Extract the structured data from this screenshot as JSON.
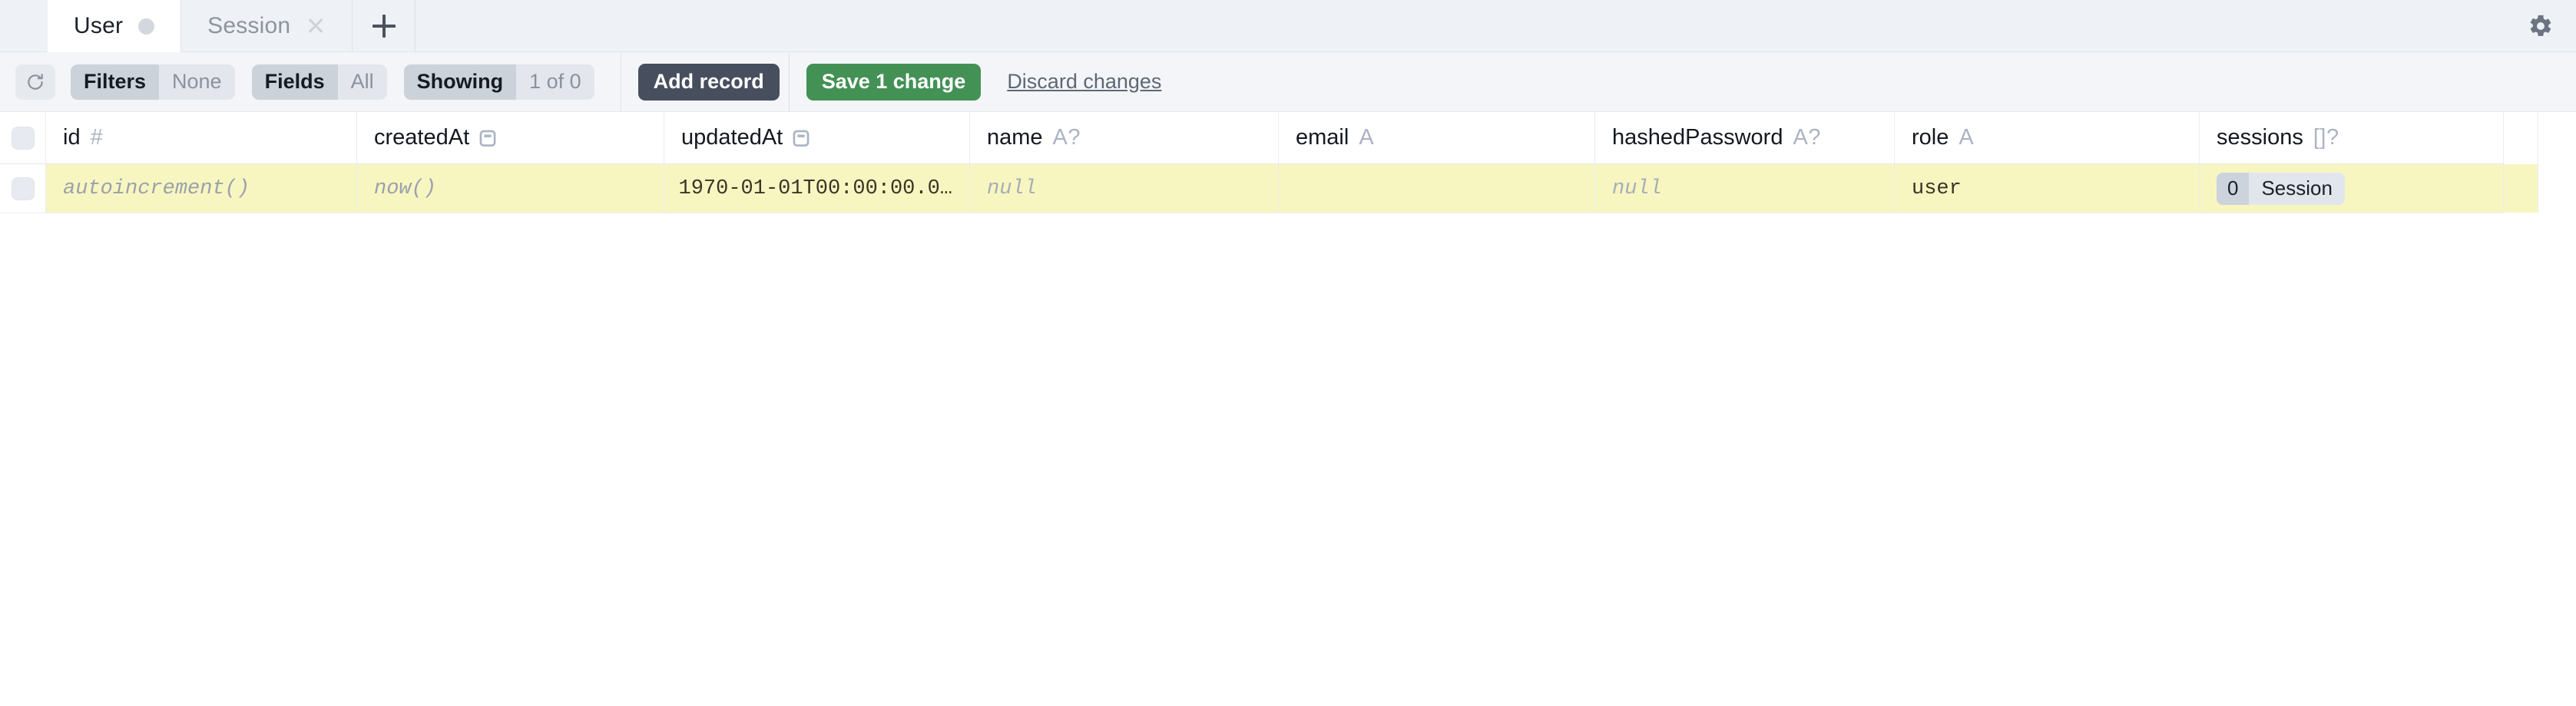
{
  "tabs": [
    {
      "label": "User",
      "active": true,
      "dirty": true,
      "closable": false,
      "name": "tab-user"
    },
    {
      "label": "Session",
      "active": false,
      "dirty": false,
      "closable": true,
      "name": "tab-session"
    }
  ],
  "tabbar": {
    "add_tab_label": "+",
    "settings_icon": "gear-icon"
  },
  "toolbar": {
    "refresh_icon": "refresh-icon",
    "filters_label": "Filters",
    "filters_value": "None",
    "fields_label": "Fields",
    "fields_value": "All",
    "showing_label": "Showing",
    "showing_value": "1 of 0",
    "add_record_label": "Add record",
    "save_label": "Save 1 change",
    "discard_label": "Discard changes"
  },
  "table": {
    "columns": [
      {
        "name": "id",
        "type": "#",
        "icon": "hash-icon"
      },
      {
        "name": "createdAt",
        "type": "",
        "icon": "calendar-icon"
      },
      {
        "name": "updatedAt",
        "type": "",
        "icon": "calendar-icon"
      },
      {
        "name": "name",
        "type": "A?",
        "icon": "string-optional-icon"
      },
      {
        "name": "email",
        "type": "A",
        "icon": "string-icon"
      },
      {
        "name": "hashedPassword",
        "type": "A?",
        "icon": "string-optional-icon"
      },
      {
        "name": "role",
        "type": "A",
        "icon": "string-icon"
      },
      {
        "name": "sessions",
        "type": "[]?",
        "icon": "list-optional-icon"
      }
    ],
    "rows": [
      {
        "changed": true,
        "selected": false,
        "id": "autoincrement()",
        "createdAt": "now()",
        "updatedAt": "1970-01-01T00:00:00.0…",
        "name": "null",
        "email": "",
        "hashedPassword": "null",
        "role": "user",
        "sessions_count": "0",
        "sessions_label": "Session"
      }
    ]
  },
  "colors": {
    "accent_green": "#439155",
    "accent_dark": "#474f5e",
    "changed_row": "#f8f6c0",
    "chrome": "#eef1f5"
  }
}
